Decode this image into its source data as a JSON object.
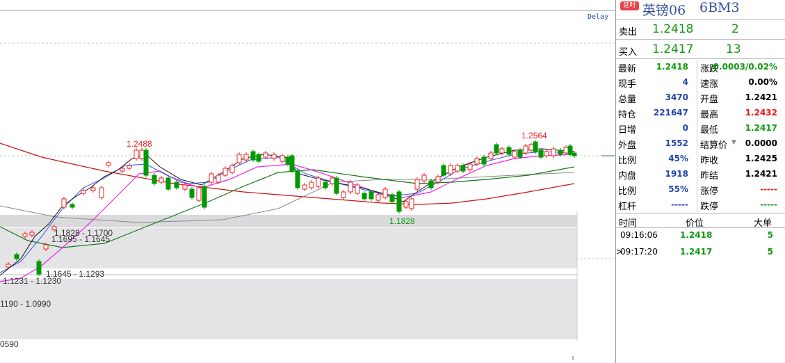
{
  "header": {
    "delay_label": "Delay",
    "badge": "延时",
    "instrument_name": "英镑06",
    "instrument_code": "6BM3"
  },
  "quote": {
    "ask_label": "卖出",
    "ask_price": "1.2418",
    "ask_volume": "2",
    "bid_label": "买入",
    "bid_price": "1.2417",
    "bid_volume": "13"
  },
  "stats_left": [
    {
      "label": "最新",
      "value": "1.2418",
      "color": "green"
    },
    {
      "label": "现手",
      "value": "4",
      "color": "blue"
    },
    {
      "label": "总量",
      "value": "3470",
      "color": "blue"
    },
    {
      "label": "持仓",
      "value": "221647",
      "color": "blue"
    },
    {
      "label": "日增",
      "value": "0",
      "color": "blue"
    },
    {
      "label": "外盘",
      "value": "1552",
      "color": "blue"
    },
    {
      "label": "比例",
      "value": "45%",
      "color": "blue"
    },
    {
      "label": "内盘",
      "value": "1918",
      "color": "blue"
    },
    {
      "label": "比例",
      "value": "55%",
      "color": "blue"
    },
    {
      "label": "杠杆",
      "value": "-----",
      "color": "blue"
    }
  ],
  "stats_right": [
    {
      "label": "涨跌",
      "value": "-0.0003/0.02%",
      "color": "green"
    },
    {
      "label": "速涨",
      "value": "0.00%",
      "color": "black"
    },
    {
      "label": "开盘",
      "value": "1.2421",
      "color": "black"
    },
    {
      "label": "最高",
      "value": "1.2432",
      "color": "red"
    },
    {
      "label": "最低",
      "value": "1.2417",
      "color": "green"
    },
    {
      "label": "结算价",
      "value": "0.0000",
      "color": "black"
    },
    {
      "label": "昨收",
      "value": "1.2425",
      "color": "black"
    },
    {
      "label": "昨结",
      "value": "1.2421",
      "color": "black"
    },
    {
      "label": "涨停",
      "value": "-----",
      "color": "red"
    },
    {
      "label": "跌停",
      "value": "-----",
      "color": "green"
    }
  ],
  "ticks": {
    "headers": [
      "时间",
      "价位",
      "大单"
    ],
    "rows": [
      {
        "time": "09:16:06",
        "price": "1.2418",
        "size": "5",
        "marker": ""
      },
      {
        "time": "09:17:20",
        "price": "1.2417",
        "size": "5",
        "marker": ">"
      }
    ]
  },
  "chart_labels": {
    "high_1": "1.2488",
    "high_2": "1.2564",
    "low_1": "1.1828",
    "zone_1": "1.1828 - 1.1700",
    "zone_2": "1.1695 - 1.1645",
    "zone_3": "1.1645 - 1.1293",
    "zone_4": "1.1231 - 1.1230",
    "zone_5": "1190 - 1.0990",
    "zone_6": "0590"
  },
  "colors": {
    "up": "#ee2222",
    "down": "#009900",
    "title": "#34509a",
    "ma_red": "#cc1111",
    "ma_green": "#117711",
    "ma_gray": "#888888",
    "ma_magenta": "#ee22ee",
    "ma_blue": "#3355ee",
    "ma_black": "#111111"
  }
}
